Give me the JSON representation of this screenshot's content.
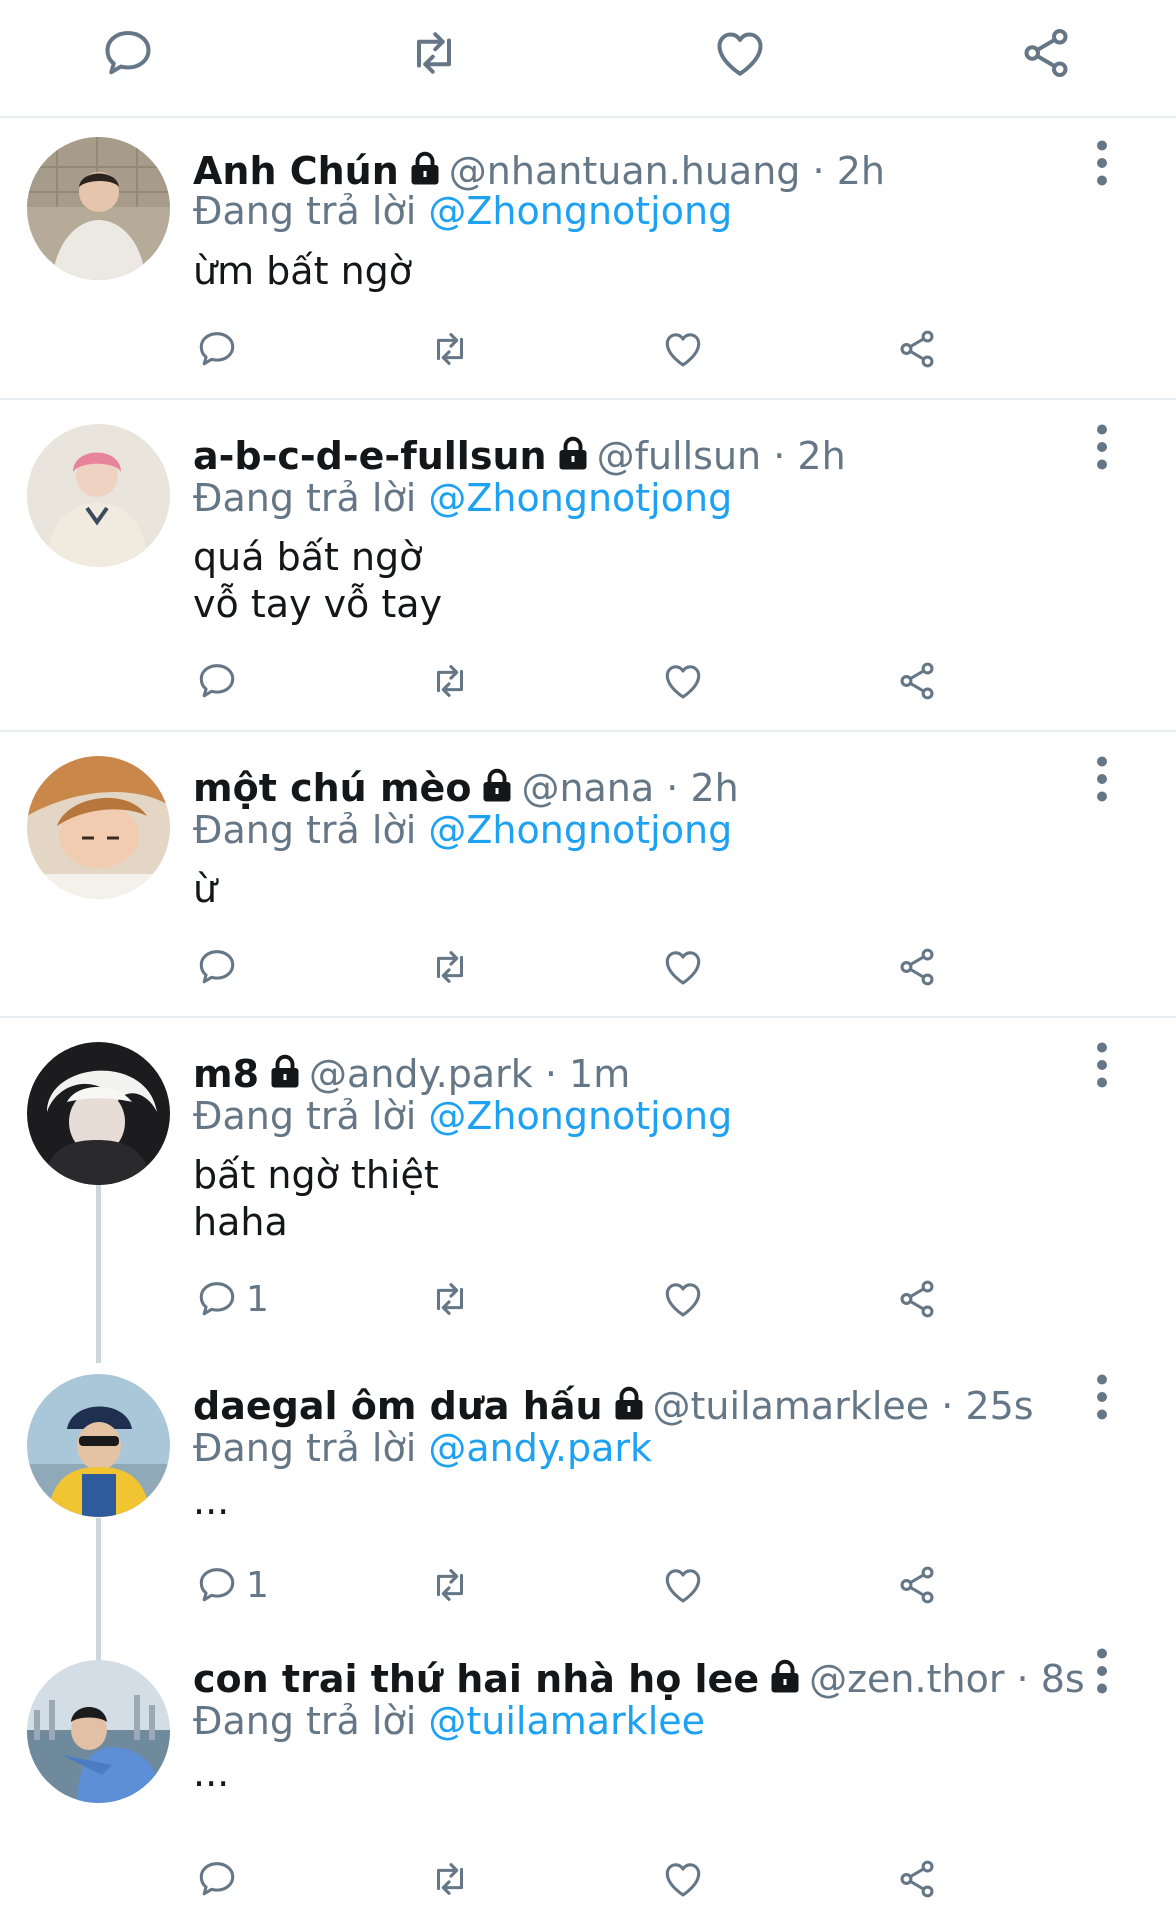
{
  "colors": {
    "accent": "#1da1f2",
    "secondary": "#657786",
    "divider": "#e6ecf0",
    "thread": "#ccd6dd"
  },
  "top_actions": {
    "icons": [
      "reply-icon",
      "retweet-icon",
      "like-icon",
      "share-icon"
    ]
  },
  "tweets": [
    {
      "name": "Anh Chún",
      "handle": "@nhantuan.huang",
      "dot": "·",
      "time": "2h",
      "reply_prefix": "Đang trả lời",
      "reply_to": "@Zhongnotjong",
      "text": "ừm bất ngờ",
      "reply_count": ""
    },
    {
      "name": "a-b-c-d-e-fullsun",
      "handle": "@fullsun",
      "dot": "·",
      "time": "2h",
      "reply_prefix": "Đang trả lời",
      "reply_to": "@Zhongnotjong",
      "text": "quá bất ngờ\nvỗ tay vỗ tay",
      "reply_count": ""
    },
    {
      "name": "một chú mèo",
      "handle": "@nana",
      "dot": "·",
      "time": "2h",
      "reply_prefix": "Đang trả lời",
      "reply_to": "@Zhongnotjong",
      "text": "ừ",
      "reply_count": ""
    },
    {
      "name": "m8",
      "handle": "@andy.park",
      "dot": "·",
      "time": "1m",
      "reply_prefix": "Đang trả lời",
      "reply_to": "@Zhongnotjong",
      "text": "bất ngờ thiệt\nhaha",
      "reply_count": "1"
    },
    {
      "name": "daegal ôm dưa hấu",
      "handle": "@tuilamarklee",
      "dot": "·",
      "time": "25s",
      "reply_prefix": "Đang trả lời",
      "reply_to": "@andy.park",
      "text": "...",
      "reply_count": "1"
    },
    {
      "name": "con trai thứ hai nhà họ lee",
      "handle": "@zen.thor",
      "dot": "·",
      "time": "8s",
      "reply_prefix": "Đang trả lời",
      "reply_to": "@tuilamarklee",
      "text": "...",
      "reply_count": ""
    }
  ]
}
